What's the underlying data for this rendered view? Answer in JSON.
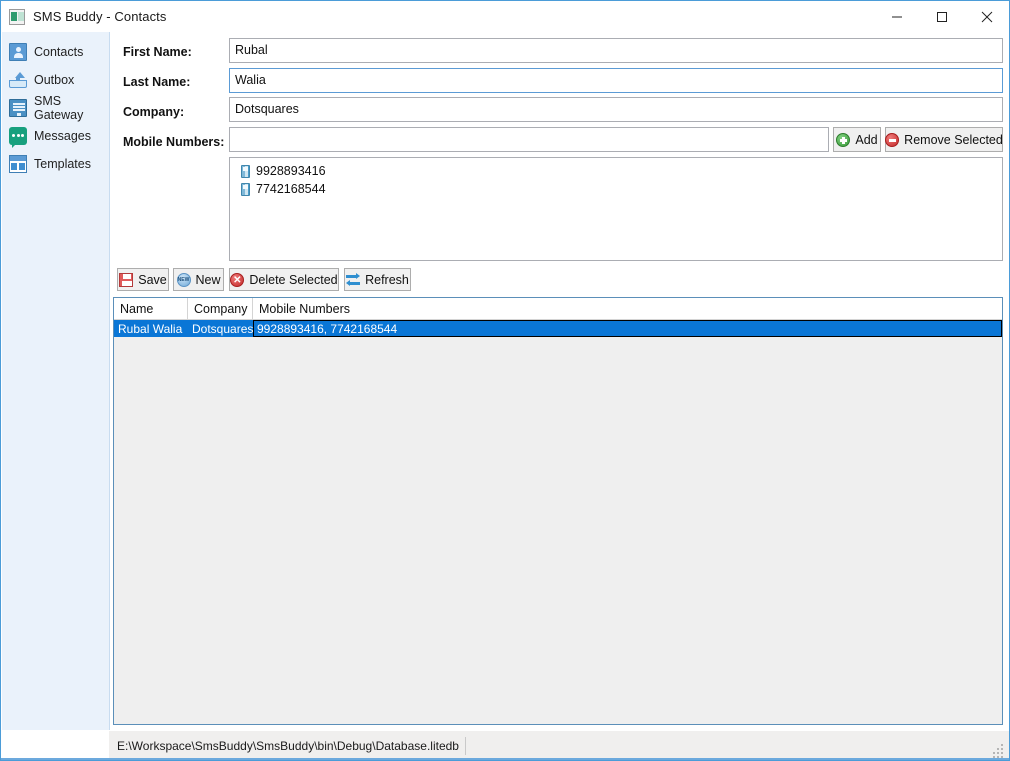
{
  "window": {
    "title": "SMS Buddy - Contacts",
    "app_icon": "app-icon",
    "controls": {
      "minimize": "minimize",
      "maximize": "maximize",
      "close": "close"
    }
  },
  "sidebar": {
    "items": [
      {
        "label": "Contacts",
        "icon": "contacts-icon",
        "selected": true
      },
      {
        "label": "Outbox",
        "icon": "outbox-icon",
        "selected": false
      },
      {
        "label": "SMS Gateway",
        "icon": "sms-gateway-icon",
        "selected": false
      },
      {
        "label": "Messages",
        "icon": "messages-icon",
        "selected": false
      },
      {
        "label": "Templates",
        "icon": "templates-icon",
        "selected": false
      }
    ]
  },
  "form": {
    "first_name": {
      "label": "First Name:",
      "value": "Rubal",
      "placeholder": ""
    },
    "last_name": {
      "label": "Last Name:",
      "value": "Walia",
      "placeholder": ""
    },
    "company": {
      "label": "Company:",
      "value": "Dotsquares",
      "placeholder": ""
    },
    "mobile_numbers": {
      "label": "Mobile Numbers:",
      "value": "",
      "placeholder": ""
    },
    "add_button": {
      "label": "Add",
      "icon": "add-circle-icon"
    },
    "remove_button": {
      "label": "Remove Selected",
      "icon": "remove-circle-icon"
    }
  },
  "number_list": {
    "items": [
      {
        "number": "9928893416",
        "icon": "mobile-phone-icon"
      },
      {
        "number": "7742168544",
        "icon": "mobile-phone-icon"
      }
    ]
  },
  "toolbar": {
    "save": {
      "label": "Save",
      "icon": "floppy-disk-icon"
    },
    "new": {
      "label": "New",
      "icon": "new-badge-icon"
    },
    "delete": {
      "label": "Delete Selected",
      "icon": "delete-circle-icon"
    },
    "refresh": {
      "label": "Refresh",
      "icon": "refresh-arrows-icon"
    }
  },
  "grid": {
    "columns": [
      "Name",
      "Company",
      "Mobile Numbers"
    ],
    "rows": [
      {
        "name": "Rubal Walia",
        "company": "Dotsquares",
        "mobile_numbers": "9928893416, 7742168544",
        "selected": true
      }
    ]
  },
  "statusbar": {
    "path": "E:\\Workspace\\SmsBuddy\\SmsBuddy\\bin\\Debug\\Database.litedb"
  },
  "colors": {
    "accent": "#0a76d6",
    "sidebar_bg": "#eaf2fb",
    "grid_border": "#5b8fb9",
    "window_border": "#4b9cd8"
  }
}
